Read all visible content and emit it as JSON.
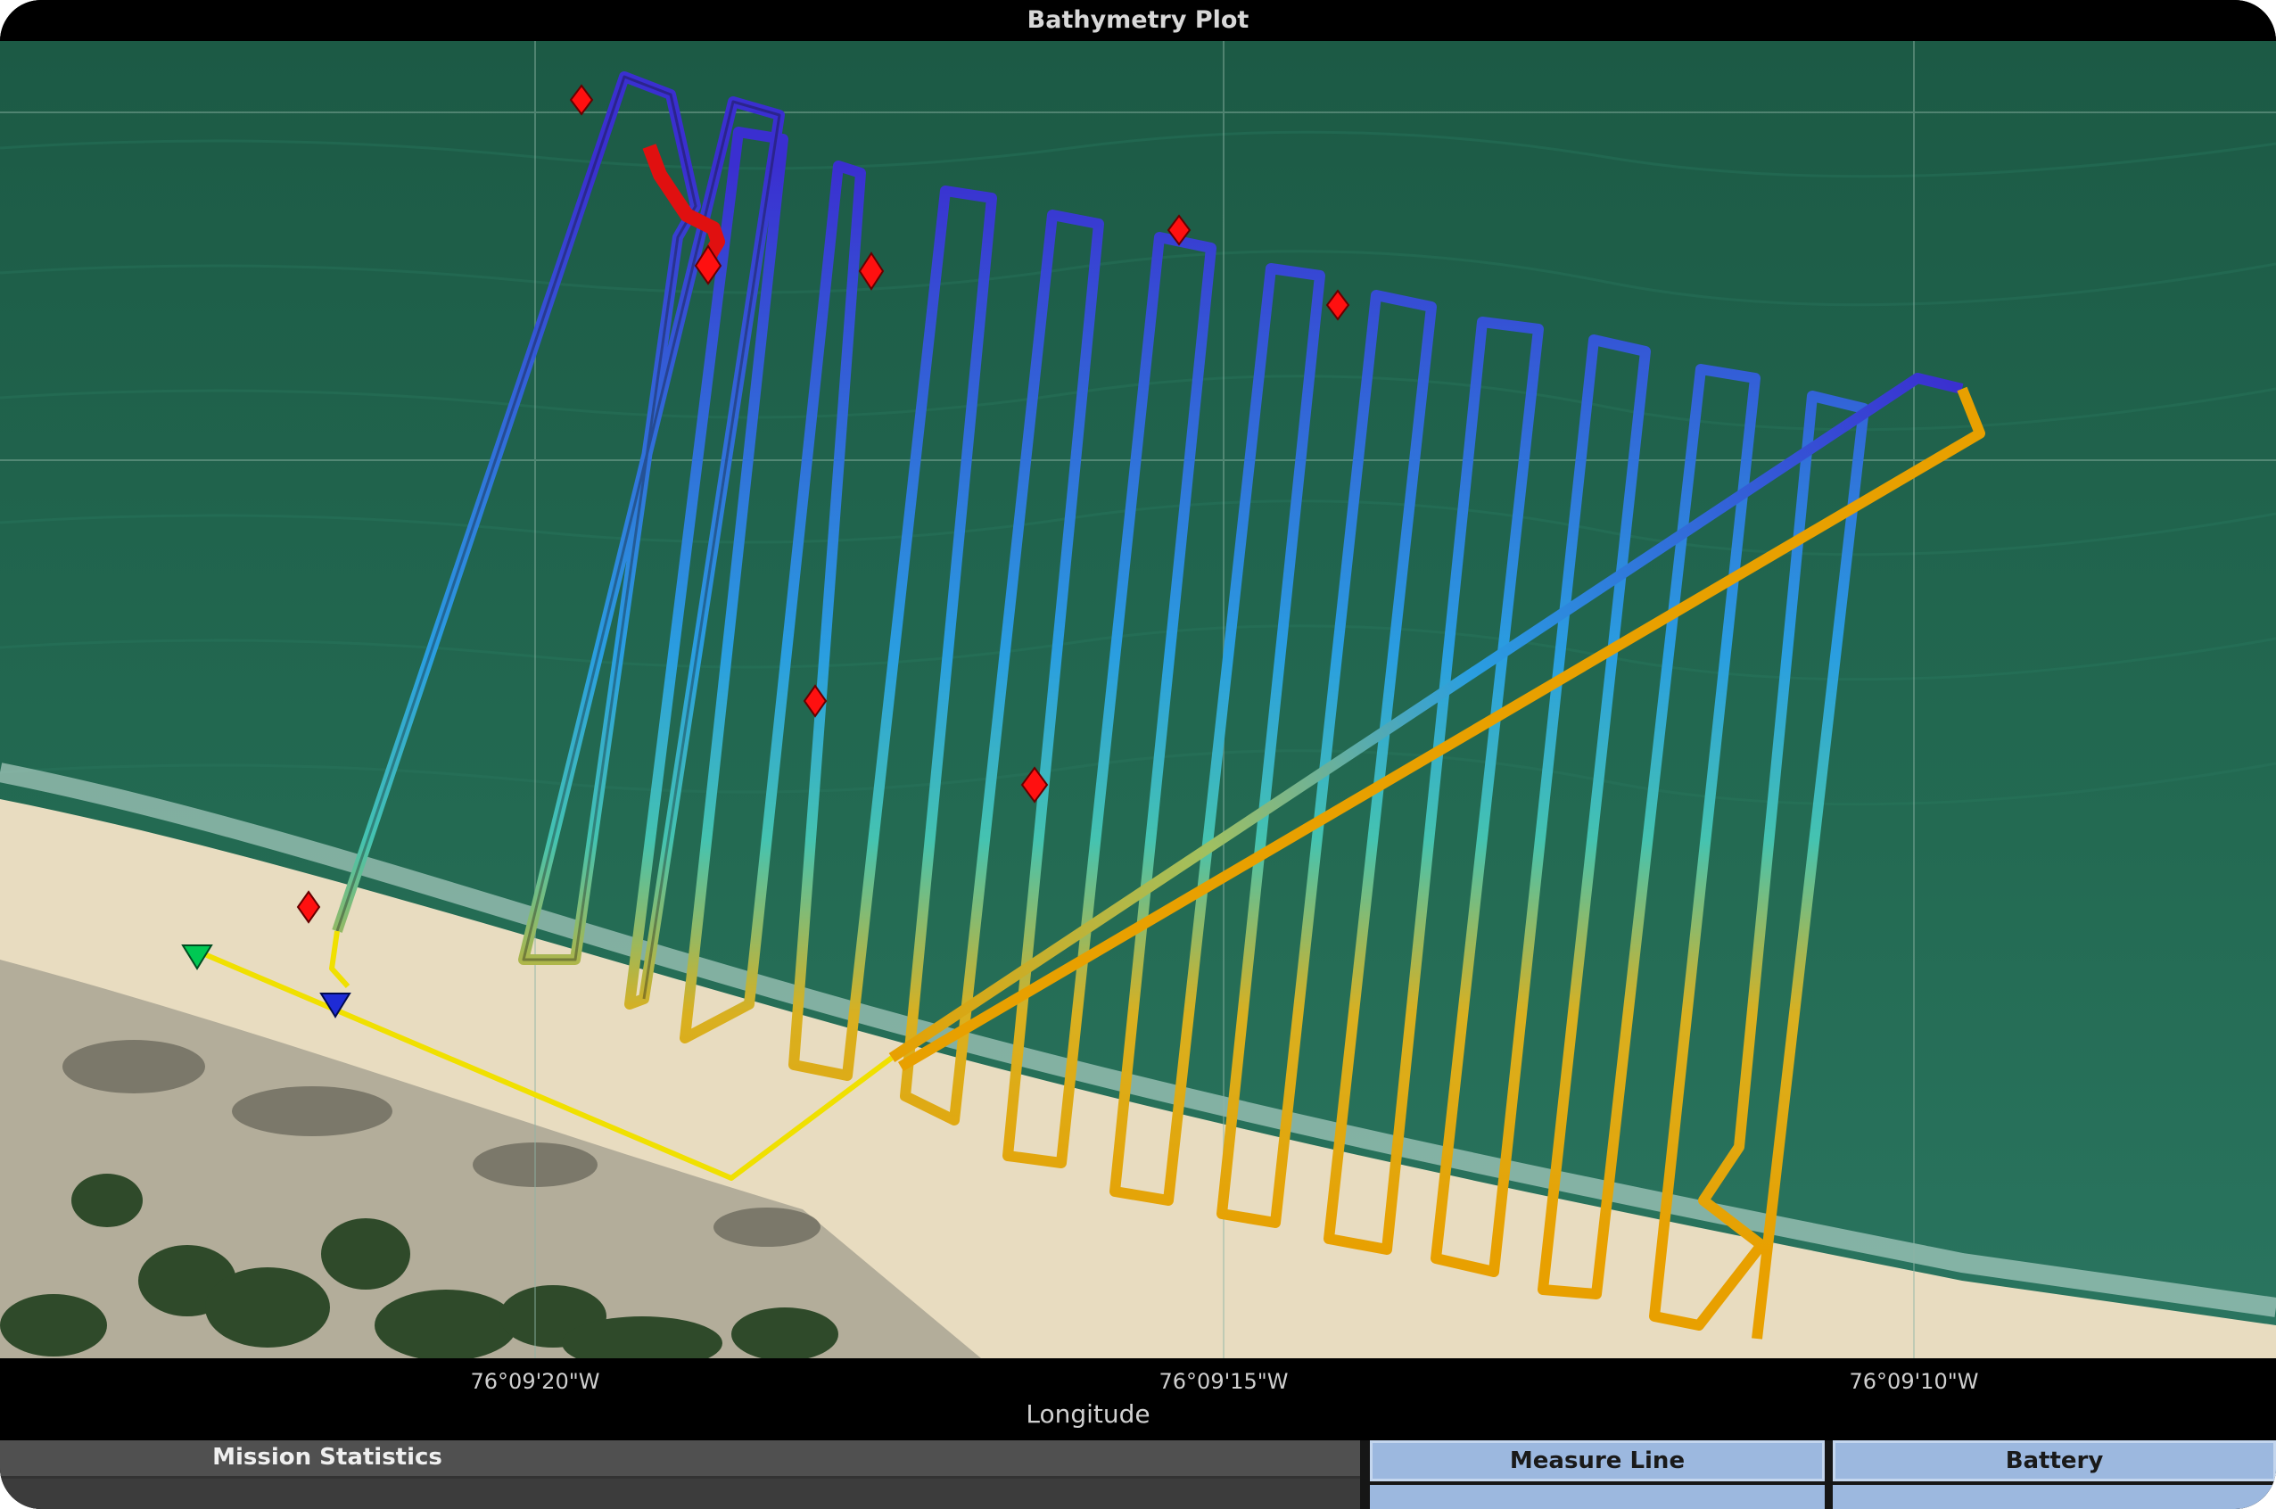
{
  "window": {
    "title": "Bathymetry Plot"
  },
  "x_axis": {
    "label": "Longitude",
    "ticks": [
      "76°09'20\"W",
      "76°09'15\"W",
      "76°09'10\"W"
    ]
  },
  "markers": {
    "start": {
      "shape": "triangle-down",
      "color": "#00c853"
    },
    "end": {
      "shape": "triangle-down",
      "color": "#1e2bd6"
    },
    "waypoints": {
      "shape": "diamond",
      "color": "#ff1010"
    }
  },
  "colors": {
    "track_deep": "#3a2fd0",
    "track_mid": "#2a9ee0",
    "track_shallow": "#e0a000",
    "transit_line": "#f0e000",
    "water": "#1f5e48",
    "sand": "#e8dcc0"
  },
  "panels": {
    "mission_statistics": "Mission Statistics",
    "measure_line": "Measure Line",
    "battery": "Battery"
  }
}
